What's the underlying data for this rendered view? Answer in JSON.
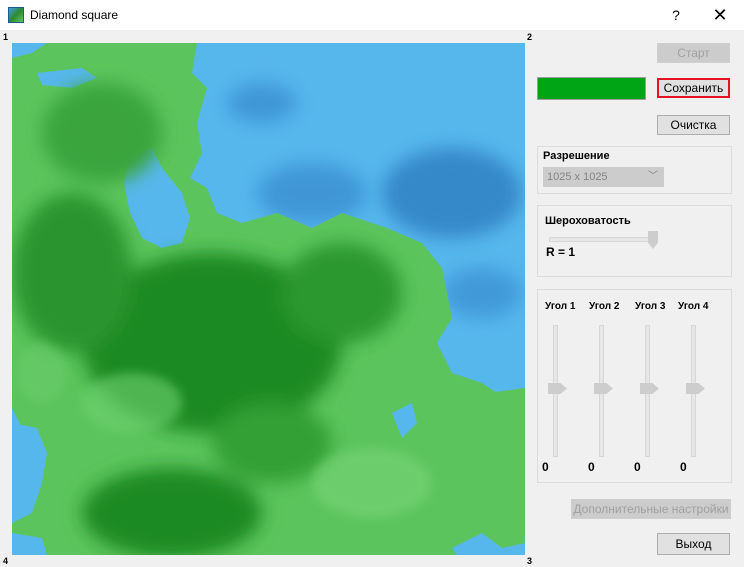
{
  "window": {
    "title": "Diamond square",
    "help": "?",
    "close": "✕"
  },
  "map": {
    "corner_labels": [
      "1",
      "2",
      "3",
      "4"
    ],
    "colors": {
      "water": "#56b7ec",
      "deep_water": "#2d7ec0",
      "land": "#5cc45c",
      "forest": "#1e8a22"
    }
  },
  "controls": {
    "start_label": "Старт",
    "save_label": "Сохранить",
    "clear_label": "Очистка",
    "color": "#00a516",
    "resolution": {
      "label": "Разрешение",
      "value": "1025 x 1025"
    },
    "roughness": {
      "label": "Шероховатость",
      "value_text": "R = 1",
      "value": 1
    },
    "corners": [
      {
        "label": "Угол 1",
        "value": "0"
      },
      {
        "label": "Угол 2",
        "value": "0"
      },
      {
        "label": "Угол 3",
        "value": "0"
      },
      {
        "label": "Угол 4",
        "value": "0"
      }
    ],
    "advanced_label": "Дополнительные настройки",
    "exit_label": "Выход"
  }
}
